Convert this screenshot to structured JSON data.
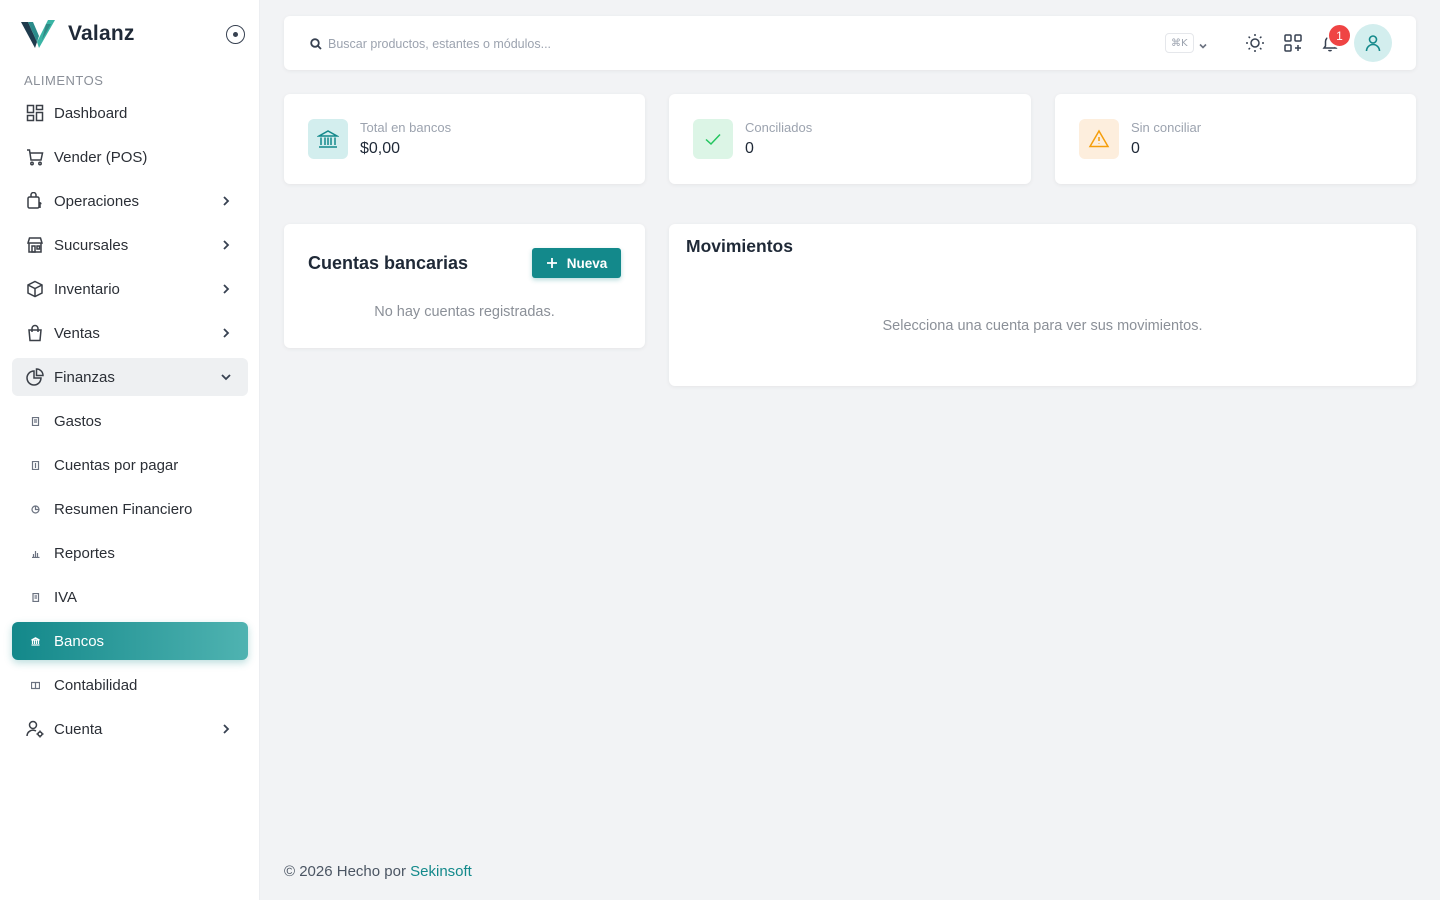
{
  "brand": {
    "name": "Valanz",
    "accent": "#13898b"
  },
  "sidebar": {
    "section_label": "ALIMENTOS",
    "items": [
      {
        "label": "Dashboard",
        "icon": "dashboard-icon"
      },
      {
        "label": "Vender (POS)",
        "icon": "cart-icon"
      },
      {
        "label": "Operaciones",
        "icon": "operations-icon"
      },
      {
        "label": "Sucursales",
        "icon": "store-icon"
      },
      {
        "label": "Inventario",
        "icon": "box-icon"
      },
      {
        "label": "Ventas",
        "icon": "bag-icon"
      },
      {
        "label": "Finanzas",
        "icon": "pie-chart-icon",
        "expanded": true
      },
      {
        "label": "Gastos",
        "icon": "expense-icon"
      },
      {
        "label": "Cuentas por pagar",
        "icon": "invoice-icon"
      },
      {
        "label": "Resumen Financiero",
        "icon": "summary-icon"
      },
      {
        "label": "Reportes",
        "icon": "bar-chart-icon"
      },
      {
        "label": "IVA",
        "icon": "receipt-icon"
      },
      {
        "label": "Bancos",
        "icon": "bank-icon",
        "active": true
      },
      {
        "label": "Contabilidad",
        "icon": "ledger-icon"
      },
      {
        "label": "Cuenta",
        "icon": "user-settings-icon"
      }
    ]
  },
  "topbar": {
    "search_placeholder": "Buscar productos, estantes o módulos...",
    "shortcut": "⌘K",
    "notifications_count": "1"
  },
  "stats": [
    {
      "label": "Total en bancos",
      "value": "$0,00",
      "icon": "bank-icon",
      "color": "#13898b"
    },
    {
      "label": "Conciliados",
      "value": "0",
      "icon": "check-icon",
      "color": "#22c55e"
    },
    {
      "label": "Sin conciliar",
      "value": "0",
      "icon": "warning-icon",
      "color": "#f59e0b"
    }
  ],
  "accounts_panel": {
    "title": "Cuentas bancarias",
    "new_button": "Nueva",
    "empty": "No hay cuentas registradas."
  },
  "movements_panel": {
    "title": "Movimientos",
    "empty": "Selecciona una cuenta para ver sus movimientos."
  },
  "footer": {
    "text": "© 2026 Hecho por ",
    "link": "Sekinsoft"
  }
}
